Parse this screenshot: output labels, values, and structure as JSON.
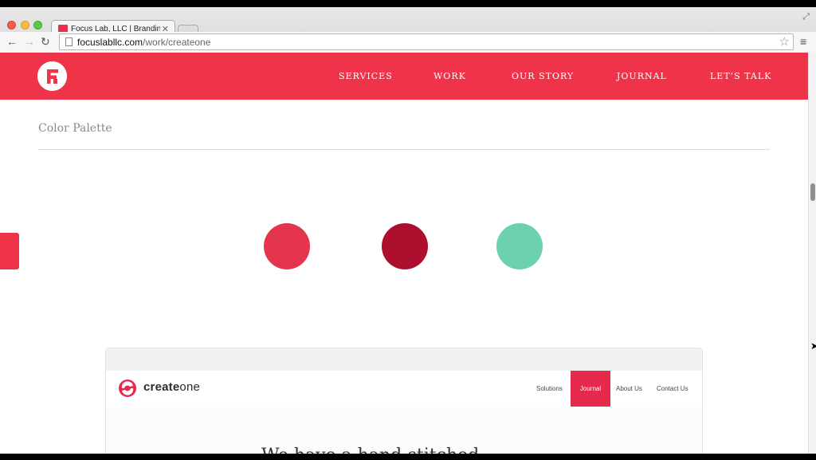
{
  "browser": {
    "tab_title": "Focus Lab, LLC | Branding",
    "tab_close": "✕",
    "url_host": "focuslabllc.com",
    "url_path": "/work/createone",
    "icons": [
      "back-arrow-icon",
      "forward-arrow-icon",
      "reload-icon",
      "page-icon",
      "star-icon",
      "hamburger-menu-icon",
      "fullscreen-icon"
    ]
  },
  "site": {
    "brand_color": "#ef3349",
    "nav": {
      "services": "SERVICES",
      "work": "WORK",
      "our_story": "OUR STORY",
      "journal": "JOURNAL",
      "lets_talk": "LET’S TALK"
    }
  },
  "section": {
    "title": "Color Palette"
  },
  "palette": {
    "swatches": [
      "#e5344d",
      "#ae0f2f",
      "#6dd0ae"
    ]
  },
  "preview": {
    "logo_bold": "create",
    "logo_light": "one",
    "nav": {
      "solutions": "Solutions",
      "journal": "Journal",
      "about": "About Us",
      "contact": "Contact Us"
    },
    "accent_color": "#e52a4d",
    "headline": "We have a hand-stitched"
  }
}
